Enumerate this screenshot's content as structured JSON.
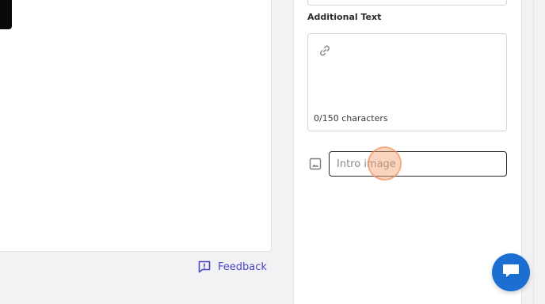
{
  "panel": {
    "additional_text_label": "Additional Text",
    "char_count": "0/150 characters",
    "intro_image_placeholder": "Intro image"
  },
  "footer": {
    "feedback_label": "Feedback"
  },
  "icons": {
    "link": "link-icon",
    "image": "image-icon",
    "feedback": "feedback-icon",
    "chat": "chat-icon"
  },
  "colors": {
    "accent": "#4a45c8",
    "chat_button": "#1b6fd1",
    "click_indicator": "#f4a06e"
  }
}
